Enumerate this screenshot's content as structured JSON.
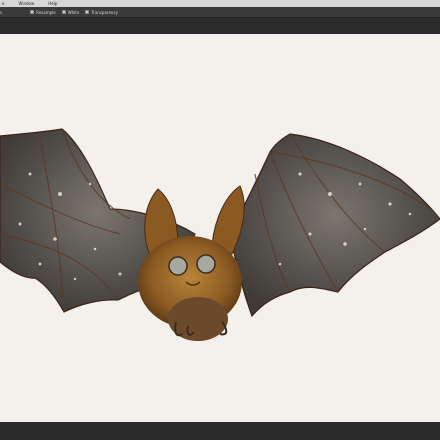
{
  "menu": [
    "e",
    "Window",
    "Help"
  ],
  "options": [
    {
      "label": "s",
      "checkbox": false
    },
    {
      "label": "Resample",
      "checkbox": true
    },
    {
      "label": "White",
      "checkbox": true
    },
    {
      "label": "Transparency",
      "checkbox": true
    }
  ],
  "canvas_subject": "bat-illustration-image"
}
